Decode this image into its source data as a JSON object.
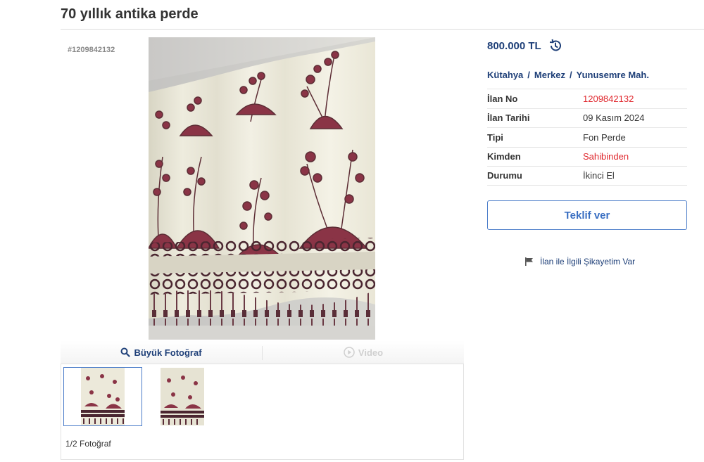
{
  "title": "70 yıllık antika perde",
  "listing_id_label": "#1209842132",
  "price": "800.000 TL",
  "location": {
    "city": "Kütahya",
    "district": "Merkez",
    "neighborhood": "Yunusemre Mah.",
    "separator": "/"
  },
  "details": [
    {
      "key": "İlan No",
      "value": "1209842132",
      "highlight": true
    },
    {
      "key": "İlan Tarihi",
      "value": "09 Kasım 2024",
      "highlight": false
    },
    {
      "key": "Tipi",
      "value": "Fon Perde",
      "highlight": false
    },
    {
      "key": "Kimden",
      "value": "Sahibinden",
      "highlight": true
    },
    {
      "key": "Durumu",
      "value": "İkinci El",
      "highlight": false
    }
  ],
  "offer_button": "Teklif ver",
  "complaint_link": "İlan ile İlgili Şikayetim Var",
  "media": {
    "big_photo_label": "Büyük Fotoğraf",
    "video_label": "Video",
    "photo_counter": "1/2 Fotoğraf"
  },
  "colors": {
    "link_blue": "#1e3f78",
    "accent_blue": "#3a6fc2",
    "highlight_red": "#e0282e"
  },
  "icons": {
    "history": "history-icon",
    "search": "search-icon",
    "play": "play-icon",
    "flag": "flag-icon"
  }
}
